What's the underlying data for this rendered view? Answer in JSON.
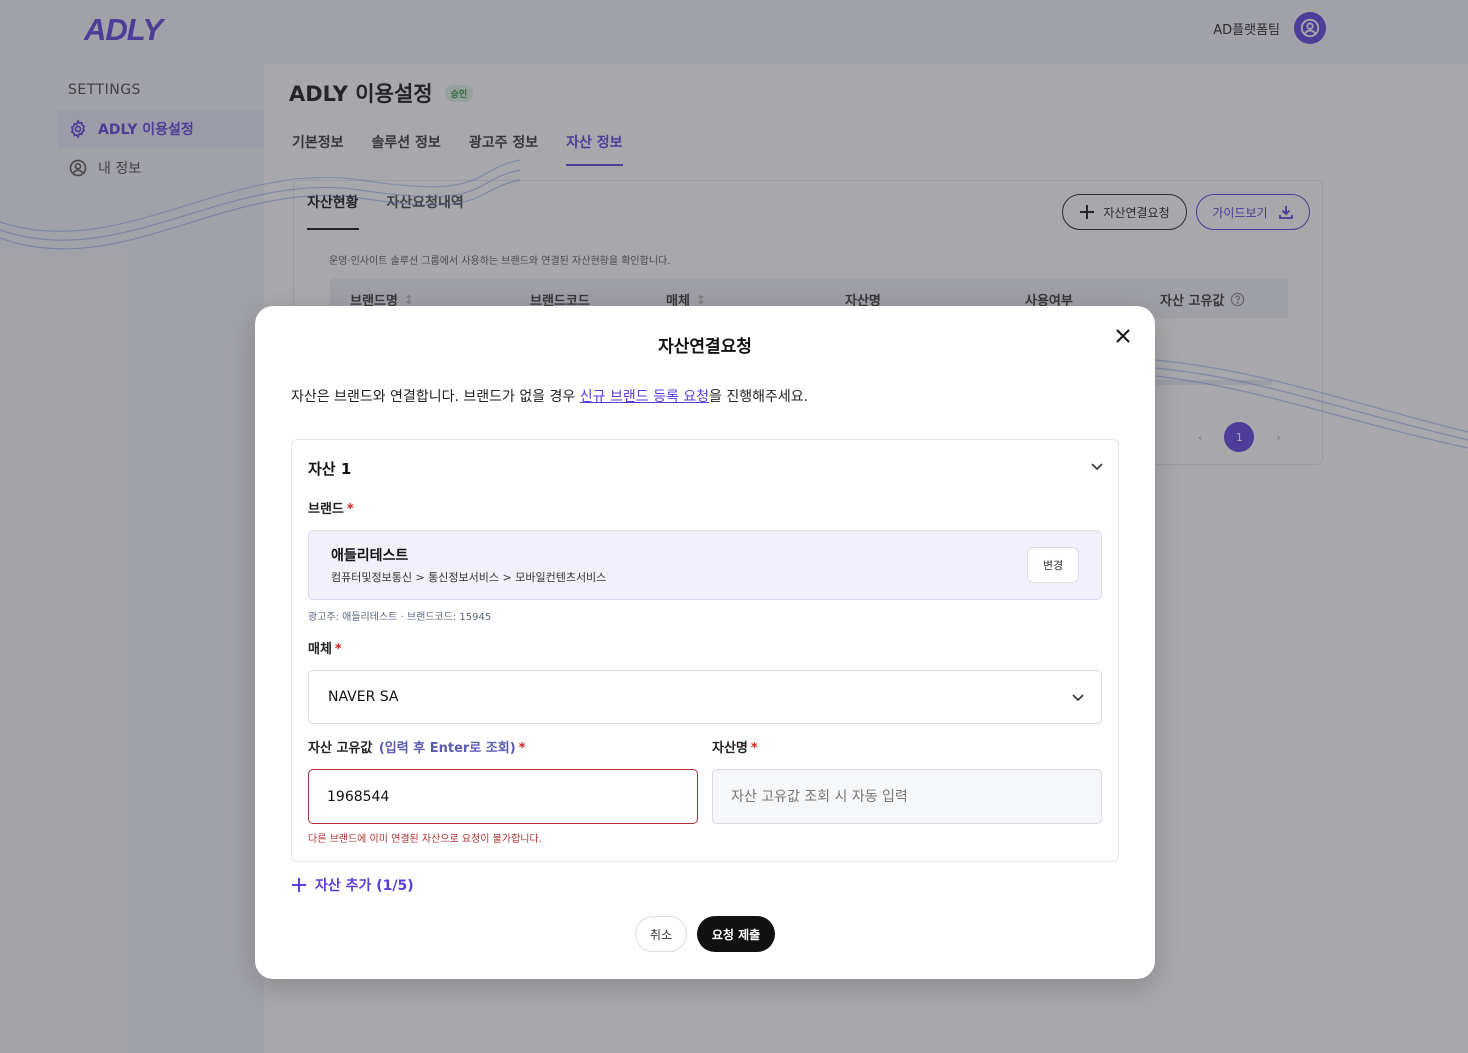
{
  "header": {
    "logo": "ADLY",
    "org_name": "AD플랫폼팀"
  },
  "sidebar": {
    "title": "SETTINGS",
    "items": [
      {
        "label": "ADLY 이용설정",
        "icon": "gear-icon",
        "active": true
      },
      {
        "label": "내 정보",
        "icon": "user-icon",
        "active": false
      }
    ]
  },
  "main": {
    "title": "ADLY 이용설정",
    "status_badge": "승인",
    "tabs": [
      {
        "label": "기본정보"
      },
      {
        "label": "솔루션 정보"
      },
      {
        "label": "광고주 정보"
      },
      {
        "label": "자산 정보",
        "active": true
      }
    ],
    "subtabs": [
      {
        "label": "자산현황",
        "active": true
      },
      {
        "label": "자산요청내역"
      }
    ],
    "request_button": "자산연결요청",
    "guide_button": "가이드보기",
    "description": "운영·인사이트 솔루션 그룹에서 사용하는 브랜드와 연결된 자산현황을 확인합니다.",
    "table": {
      "columns": [
        "브랜드명",
        "브랜드코드",
        "매체",
        "자산명",
        "사용여부",
        "자산 고유값"
      ]
    },
    "pagination": {
      "prev": "‹",
      "current": "1",
      "next": "›"
    }
  },
  "modal": {
    "title": "자산연결요청",
    "intro_before": "자산은 브랜드와 연결합니다. 브랜드가 없을 경우 ",
    "intro_link": "신규 브랜드 등록 요청",
    "intro_after": "을 진행해주세요.",
    "asset": {
      "title": "자산 1",
      "brand_label": "브랜드",
      "required_mark": "*",
      "brand_name": "애들리테스트",
      "brand_category": "컴퓨터및정보통신 > 통신정보서비스 > 모바일컨텐츠서비스",
      "change_button": "변경",
      "brand_meta": "광고주: 애들리테스트 · 브랜드코드: 15945",
      "media_label": "매체",
      "media_value": "NAVER SA",
      "uid_label": "자산 고유값",
      "uid_hint": "(입력 후 Enter로 조회)",
      "uid_value": "1968544",
      "name_label": "자산명",
      "name_placeholder": "자산 고유값 조회 시 자동 입력",
      "error_message": "다른 브랜드에 이미 연결된 자산으로 요청이 불가합니다."
    },
    "add_asset": "자산 추가 (1/5)",
    "cancel_button": "취소",
    "submit_button": "요청 제출"
  },
  "colors": {
    "brand": "#5b3cdb",
    "error": "#b03030",
    "required": "#d92020",
    "submit": "#111111"
  }
}
